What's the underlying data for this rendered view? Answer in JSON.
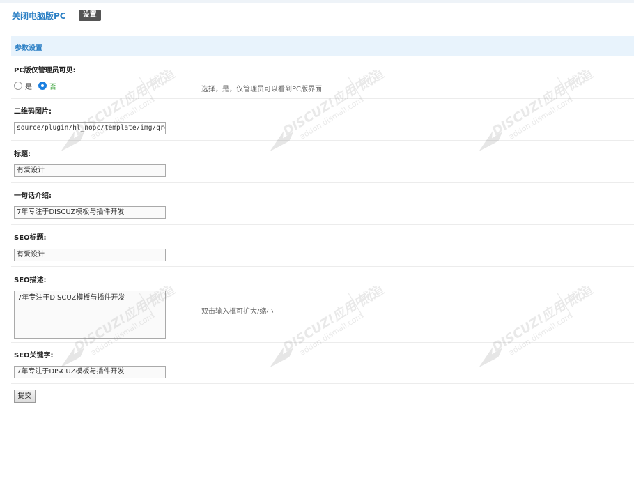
{
  "header": {
    "title": "关闭电脑版PC",
    "settings_label": "设置"
  },
  "section": {
    "title": "参数设置"
  },
  "fields": {
    "pc_admin_visible": {
      "label": "PC版仅管理员可见:",
      "options": [
        "是",
        "否"
      ],
      "selected": "否",
      "hint": "选择，是，仅管理员可以看到PC版界面"
    },
    "qrcode": {
      "label": "二维码图片:",
      "value": "source/plugin/hl_nopc/template/img/qrcc"
    },
    "title": {
      "label": "标题:",
      "value": "有爱设计"
    },
    "intro": {
      "label": "一句话介绍:",
      "value": "7年专注于DISCUZ模板与插件开发"
    },
    "seo_title": {
      "label": "SEO标题:",
      "value": "有爱设计"
    },
    "seo_desc": {
      "label": "SEO描述:",
      "value": "7年专注于DISCUZ模板与插件开发",
      "hint": "双击输入框可扩大/缩小"
    },
    "seo_keywords": {
      "label": "SEO关键字:",
      "value": "7年专注于DISCUZ模板与插件开发"
    }
  },
  "submit_label": "提交",
  "watermark": {
    "brand": "DISCUZ!应用中心",
    "domain": "addon.dismall.com",
    "mark": "贰道",
    "registered": "®"
  },
  "colors": {
    "link_blue": "#2b7fc4",
    "section_bg": "#e8f3fc",
    "radio_checked": "#1a7fe0",
    "selected_label": "#4aaa4a"
  }
}
